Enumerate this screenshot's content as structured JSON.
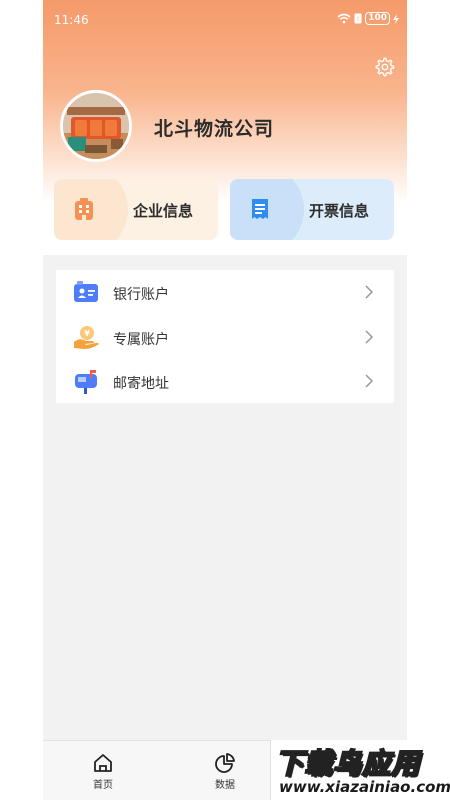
{
  "status_bar": {
    "time": "11:46",
    "battery": "100"
  },
  "profile": {
    "company_name": "北斗物流公司"
  },
  "cards": {
    "enterprise": {
      "label": "企业信息"
    },
    "invoice": {
      "label": "开票信息"
    }
  },
  "menu": {
    "items": [
      {
        "label": "银行账户",
        "icon": "bank-card-icon"
      },
      {
        "label": "专属账户",
        "icon": "hand-coin-icon"
      },
      {
        "label": "邮寄地址",
        "icon": "mailbox-icon"
      }
    ]
  },
  "bottom_nav": {
    "items": [
      {
        "label": "首页",
        "icon": "home-icon"
      },
      {
        "label": "数据",
        "icon": "pie-chart-icon"
      }
    ]
  },
  "watermark": {
    "title": "下载鸟应用",
    "url": "www.xiazainiao.com"
  },
  "colors": {
    "header_orange": "#f59a6a",
    "enterprise_card": "#fdf1e4",
    "invoice_card": "#dcecfb",
    "enterprise_icon": "#f59154",
    "invoice_icon": "#2f8cf0",
    "menu_icon_blue": "#4f7cf7",
    "menu_icon_orange": "#f6a23b"
  }
}
